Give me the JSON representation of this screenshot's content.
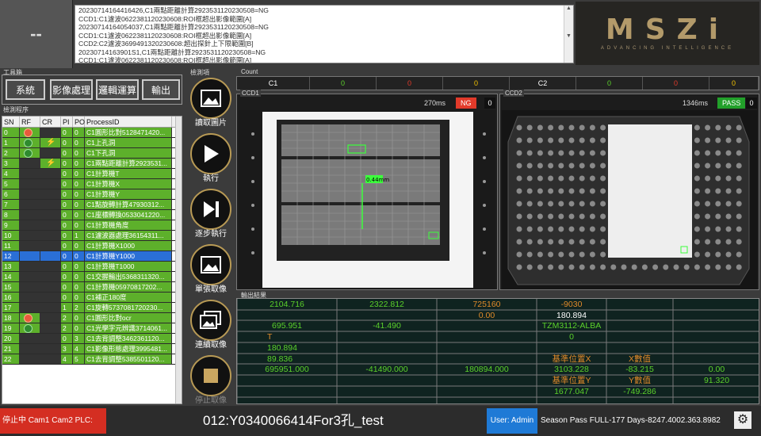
{
  "header": {
    "dash": "--"
  },
  "log": {
    "lines": [
      "20230714164416426,C1兩點距離計算2923531120230508=NG",
      "CCD1:C1濾波0622381120230608:ROI框超出影像範圍[A]",
      "20230714164054037,C1兩點距離計算2923531120230508=NG",
      "CCD1:C1濾波0622381120230608:ROI框超出影像範圍[A]",
      "CCD2:C2濾波3699491320230608:超出探針上下限範圍[B]",
      "20230714163901S1,C1兩點距離計算2923531120230508=NG",
      "CCD1:C1濾波0622381120230608:ROI框超出影像範圍[A]"
    ]
  },
  "logo": {
    "mark": "MSZi",
    "sub": "ADVANCING INTELLIGENCE"
  },
  "toolbox": {
    "label": "工具箱",
    "buttons": [
      "系統",
      "影像處理",
      "邏輯運算",
      "輸出"
    ]
  },
  "detection": {
    "label": "檢測程序",
    "headers": [
      "SN",
      "RF",
      "CR",
      "PI",
      "PO",
      "ProcessID"
    ],
    "rows": [
      {
        "sn": "0",
        "rf": "red",
        "cr": "",
        "pi": "0",
        "po": "0",
        "pid": "C1圓形比對5128471420..."
      },
      {
        "sn": "1",
        "rf": "green",
        "cr": "bolt",
        "pi": "0",
        "po": "0",
        "pid": "C1上孔洞"
      },
      {
        "sn": "2",
        "rf": "green",
        "cr": "",
        "pi": "0",
        "po": "0",
        "pid": "C1下孔洞"
      },
      {
        "sn": "3",
        "rf": "",
        "cr": "bolt",
        "pi": "0",
        "po": "0",
        "pid": "C1兩點距離計算2923531..."
      },
      {
        "sn": "4",
        "rf": "",
        "cr": "",
        "pi": "0",
        "po": "0",
        "pid": "C1計算機T"
      },
      {
        "sn": "5",
        "rf": "",
        "cr": "",
        "pi": "0",
        "po": "0",
        "pid": "C1計算機X"
      },
      {
        "sn": "6",
        "rf": "",
        "cr": "",
        "pi": "0",
        "po": "0",
        "pid": "C1計算機Y"
      },
      {
        "sn": "7",
        "rf": "",
        "cr": "",
        "pi": "0",
        "po": "0",
        "pid": "C1點旋轉計算47930312..."
      },
      {
        "sn": "8",
        "rf": "",
        "cr": "",
        "pi": "0",
        "po": "0",
        "pid": "C1座標轉換0533041220..."
      },
      {
        "sn": "9",
        "rf": "",
        "cr": "",
        "pi": "0",
        "po": "0",
        "pid": "C1計算機角度"
      },
      {
        "sn": "10",
        "rf": "",
        "cr": "",
        "pi": "0",
        "po": "1",
        "pid": "C1濾波器處理36154311..."
      },
      {
        "sn": "11",
        "rf": "",
        "cr": "",
        "pi": "0",
        "po": "0",
        "pid": "C1計算機X1000"
      },
      {
        "sn": "12",
        "rf": "",
        "cr": "",
        "pi": "0",
        "po": "0",
        "pid": "C1計算機Y1000",
        "sel": true
      },
      {
        "sn": "13",
        "rf": "",
        "cr": "",
        "pi": "0",
        "po": "0",
        "pid": "C1計算機T1000"
      },
      {
        "sn": "14",
        "rf": "",
        "cr": "",
        "pi": "0",
        "po": "0",
        "pid": "C1交握輸出5368311320..."
      },
      {
        "sn": "15",
        "rf": "",
        "cr": "",
        "pi": "0",
        "po": "0",
        "pid": "C1計算機05970817202..."
      },
      {
        "sn": "16",
        "rf": "",
        "cr": "",
        "pi": "0",
        "po": "0",
        "pid": "C1補正180度"
      },
      {
        "sn": "17",
        "rf": "",
        "cr": "",
        "pi": "1",
        "po": "2",
        "pid": "C1旋轉5737081720230..."
      },
      {
        "sn": "18",
        "rf": "red",
        "cr": "",
        "pi": "2",
        "po": "0",
        "pid": "C1圓形比對ocr"
      },
      {
        "sn": "19",
        "rf": "green",
        "cr": "",
        "pi": "2",
        "po": "0",
        "pid": "C1光學字元辨識3714061..."
      },
      {
        "sn": "20",
        "rf": "",
        "cr": "",
        "pi": "0",
        "po": "3",
        "pid": "C1去背調整3462361120..."
      },
      {
        "sn": "21",
        "rf": "",
        "cr": "",
        "pi": "3",
        "po": "4",
        "pid": "C1影像形態處理3995481..."
      },
      {
        "sn": "22",
        "rf": "",
        "cr": "",
        "pi": "4",
        "po": "5",
        "pid": "C1去背調整5385501120..."
      }
    ]
  },
  "flow": {
    "label": "檢測項",
    "buttons": [
      "讀取圖片",
      "執行",
      "逐步執行",
      "單張取像",
      "連續取像",
      "停止取像"
    ]
  },
  "count": {
    "label": "Count",
    "cells": [
      {
        "text": "C1",
        "color": "#ffffff"
      },
      {
        "text": "0",
        "color": "#5bd12b"
      },
      {
        "text": "0",
        "color": "#e23a2a"
      },
      {
        "text": "0",
        "color": "#f2c200"
      },
      {
        "text": "C2",
        "color": "#ffffff"
      },
      {
        "text": "0",
        "color": "#5bd12b"
      },
      {
        "text": "0",
        "color": "#e23a2a"
      },
      {
        "text": "0",
        "color": "#f2c200"
      }
    ]
  },
  "ccd1": {
    "label": "CCD1",
    "ms": "270ms",
    "result": "NG",
    "count": "0",
    "measure_label": "0.44mm"
  },
  "ccd2": {
    "label": "CCD2",
    "ms": "1346ms",
    "result": "PASS",
    "count": "0"
  },
  "output": {
    "label": "輸出結果",
    "cells": [
      {
        "t": "2104.716",
        "c": "#5bd12b",
        "r": 0,
        "col": 0
      },
      {
        "t": "2322.812",
        "c": "#5bd12b",
        "r": 0,
        "col": 1
      },
      {
        "t": "725160",
        "c": "#e08a2a",
        "r": 0,
        "col": 2
      },
      {
        "t": "-9030",
        "c": "#e08a2a",
        "r": 0,
        "col": 3
      },
      {
        "t": "0.00",
        "c": "#e08a2a",
        "r": 1,
        "col": 2
      },
      {
        "t": "180.894",
        "c": "#ffffff",
        "r": 1,
        "col": 3
      },
      {
        "t": "695.951",
        "c": "#5bd12b",
        "r": 2,
        "col": 0
      },
      {
        "t": "-41.490",
        "c": "#5bd12b",
        "r": 2,
        "col": 1
      },
      {
        "t": "TZM3112-ALBA",
        "c": "#5bd12b",
        "r": 2,
        "col": 3
      },
      {
        "t": "T",
        "c": "#e08a2a",
        "r": 3,
        "col": 0
      },
      {
        "t": "0",
        "c": "#5bd12b",
        "r": 3,
        "col": 3
      },
      {
        "t": "180.894",
        "c": "#5bd12b",
        "r": 4,
        "col": 0
      },
      {
        "t": "89.836",
        "c": "#5bd12b",
        "r": 5,
        "col": 0
      },
      {
        "t": "基準位置X",
        "c": "#e08a2a",
        "r": 5,
        "col": 3
      },
      {
        "t": "X數值",
        "c": "#e08a2a",
        "r": 5,
        "col": 4
      },
      {
        "t": "695951.000",
        "c": "#5bd12b",
        "r": 6,
        "col": 0
      },
      {
        "t": "-41490.000",
        "c": "#5bd12b",
        "r": 6,
        "col": 1
      },
      {
        "t": "180894.000",
        "c": "#5bd12b",
        "r": 6,
        "col": 2
      },
      {
        "t": "3103.228",
        "c": "#5bd12b",
        "r": 6,
        "col": 3
      },
      {
        "t": "-83.215",
        "c": "#5bd12b",
        "r": 6,
        "col": 4
      },
      {
        "t": "0.00",
        "c": "#5bd12b",
        "r": 6,
        "col": 5
      },
      {
        "t": "基準位置Y",
        "c": "#e08a2a",
        "r": 7,
        "col": 3
      },
      {
        "t": "Y數值",
        "c": "#e08a2a",
        "r": 7,
        "col": 4
      },
      {
        "t": "91.320",
        "c": "#5bd12b",
        "r": 7,
        "col": 5
      },
      {
        "t": "1677.047",
        "c": "#5bd12b",
        "r": 8,
        "col": 3
      },
      {
        "t": "-749.286",
        "c": "#5bd12b",
        "r": 8,
        "col": 4
      }
    ]
  },
  "status": {
    "stop": "停止中  Cam1  Cam2  PLC:",
    "product": "012:Y0340066414For3孔_test",
    "user": "User: Admin",
    "season": "Season Pass FULL-177 Days-8247.4002.363.8982"
  },
  "colors": {
    "green": "#5db02b",
    "ng": "#e23a2a",
    "pass": "#22a02a",
    "blue": "#1f7ad6",
    "gold": "#b89a55"
  }
}
